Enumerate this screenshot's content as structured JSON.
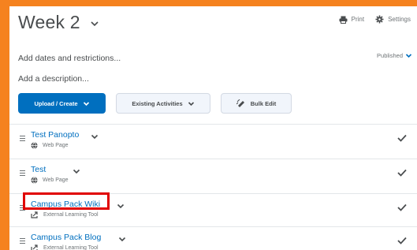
{
  "header": {
    "title": "Week 2",
    "print_label": "Print",
    "settings_label": "Settings"
  },
  "meta": {
    "dates_text": "Add dates and restrictions...",
    "published_label": "Published",
    "description_text": "Add a description..."
  },
  "toolbar": {
    "upload_label": "Upload / Create",
    "existing_label": "Existing Activities",
    "bulk_label": "Bulk Edit"
  },
  "items": [
    {
      "title": "Test Panopto",
      "type": "Web Page",
      "icon": "globe-icon"
    },
    {
      "title": "Test",
      "type": "Web Page",
      "icon": "globe-icon"
    },
    {
      "title": "Campus Pack Wiki",
      "type": "External Learning Tool",
      "icon": "external-tool-icon"
    },
    {
      "title": "Campus Pack Blog",
      "type": "External Learning Tool",
      "icon": "external-tool-icon"
    }
  ],
  "colors": {
    "accent": "#006fbf",
    "frame": "#f5821f",
    "highlight": "#e00000"
  }
}
